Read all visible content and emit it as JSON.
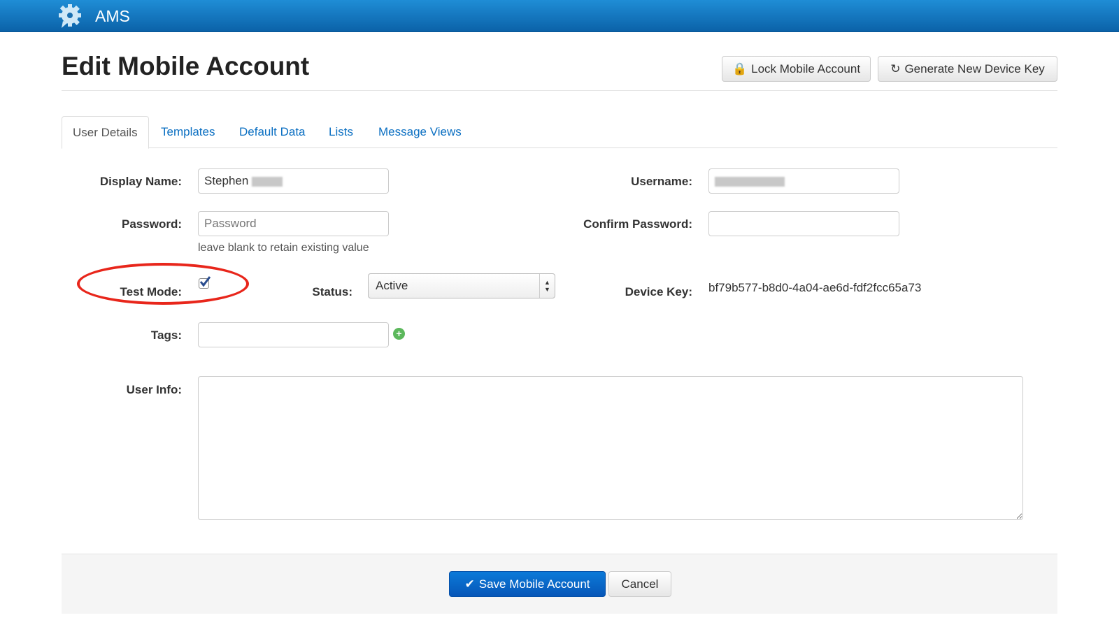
{
  "app": {
    "title": "AMS",
    "logo_icon": "gear-icon"
  },
  "page": {
    "title": "Edit Mobile Account"
  },
  "actions": {
    "lock": "Lock Mobile Account",
    "generate": "Generate New Device Key"
  },
  "tabs": [
    {
      "label": "User Details"
    },
    {
      "label": "Templates"
    },
    {
      "label": "Default Data"
    },
    {
      "label": "Lists"
    },
    {
      "label": "Message Views"
    }
  ],
  "form": {
    "display_name_label": "Display Name:",
    "display_name_value": "Stephen",
    "username_label": "Username:",
    "password_label": "Password:",
    "password_placeholder": "Password",
    "password_help": "leave blank to retain existing value",
    "confirm_label": "Confirm Password:",
    "test_mode_label": "Test Mode:",
    "test_mode_checked": true,
    "status_label": "Status:",
    "status_value": "Active",
    "device_key_label": "Device Key:",
    "device_key_value": "bf79b577-b8d0-4a04-ae6d-fdf2fcc65a73",
    "tags_label": "Tags:",
    "user_info_label": "User Info:"
  },
  "footer": {
    "save": "Save Mobile Account",
    "cancel": "Cancel"
  },
  "colors": {
    "nav": "#0b62a8",
    "primary": "#0b6fc2",
    "annotation": "#e8261b"
  }
}
